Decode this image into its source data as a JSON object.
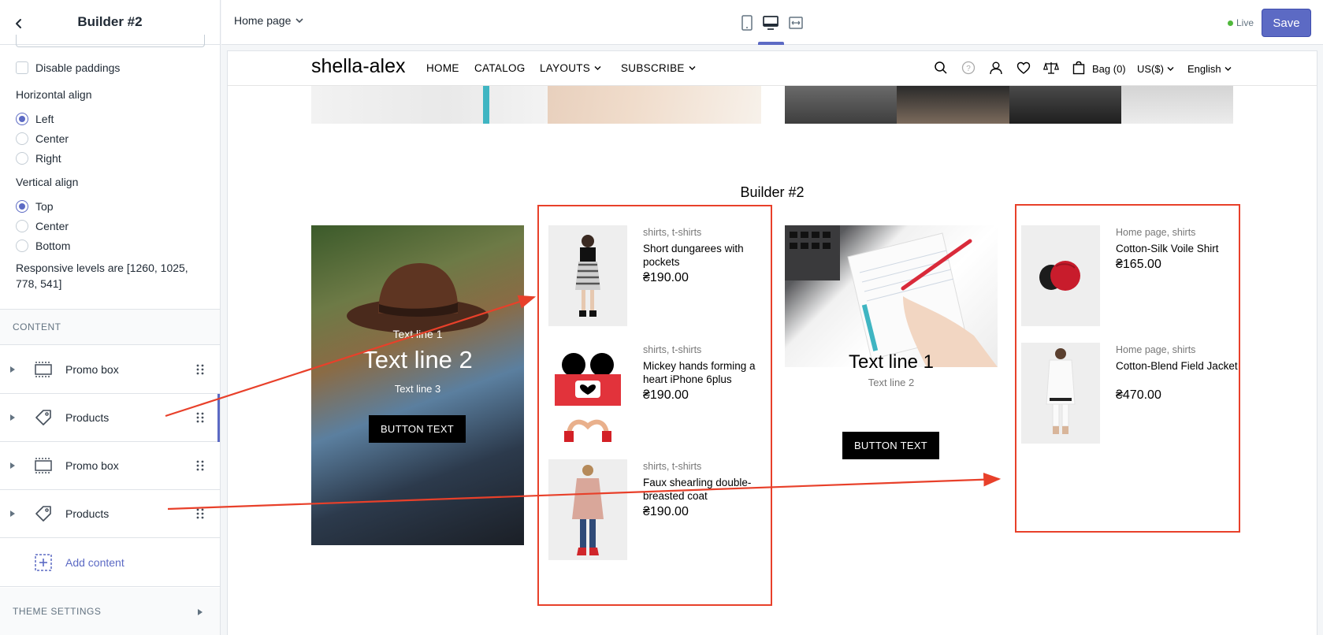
{
  "colors": {
    "accent": "#5c6ac4",
    "annotation": "#e8402a",
    "live": "#50b83c"
  },
  "sidebar": {
    "title": "Builder #2",
    "back_icon": "chevron-left-icon",
    "disable_paddings_label": "Disable paddings",
    "horizontal_align": {
      "label": "Horizontal align",
      "options": [
        "Left",
        "Center",
        "Right"
      ],
      "selected": "Left"
    },
    "vertical_align": {
      "label": "Vertical align",
      "options": [
        "Top",
        "Center",
        "Bottom"
      ],
      "selected": "Top"
    },
    "responsive_note": "Responsive levels are [1260, 1025, 778, 541]",
    "content_header": "CONTENT",
    "content_items": [
      {
        "label": "Promo box",
        "icon": "promo-box-icon"
      },
      {
        "label": "Products",
        "icon": "tag-icon"
      },
      {
        "label": "Promo box",
        "icon": "promo-box-icon"
      },
      {
        "label": "Products",
        "icon": "tag-icon"
      }
    ],
    "add_content_label": "Add content",
    "theme_settings_label": "THEME SETTINGS"
  },
  "topbar": {
    "page_select": "Home page",
    "live_label": "Live",
    "save_label": "Save"
  },
  "store": {
    "logo": "shella-alex",
    "nav": [
      "HOME",
      "CATALOG",
      "LAYOUTS",
      "SUBSCRIBE"
    ],
    "bag_label": "Bag (0)",
    "currency": "US($)",
    "language": "English",
    "section_title": "Builder #2",
    "promo_left": {
      "line1": "Text line 1",
      "line2": "Text line 2",
      "line3": "Text line 3",
      "button": "BUTTON TEXT"
    },
    "products_left": [
      {
        "category": "shirts, t-shirts",
        "name": "Short dungarees with pockets",
        "price": "₴190.00"
      },
      {
        "category": "shirts, t-shirts",
        "name": "Mickey hands forming a heart iPhone 6plus",
        "price": "₴190.00"
      },
      {
        "category": "shirts, t-shirts",
        "name": "Faux shearling double-breasted coat",
        "price": "₴190.00"
      }
    ],
    "promo_mid": {
      "line1": "Text line 1",
      "line2": "Text line 2",
      "button": "BUTTON TEXT"
    },
    "products_right": [
      {
        "category": "Home page, shirts",
        "name": "Cotton-Silk Voile Shirt",
        "price": "₴165.00"
      },
      {
        "category": "Home page, shirts",
        "name": "Cotton-Blend Field Jacket",
        "price": "₴470.00"
      }
    ]
  }
}
